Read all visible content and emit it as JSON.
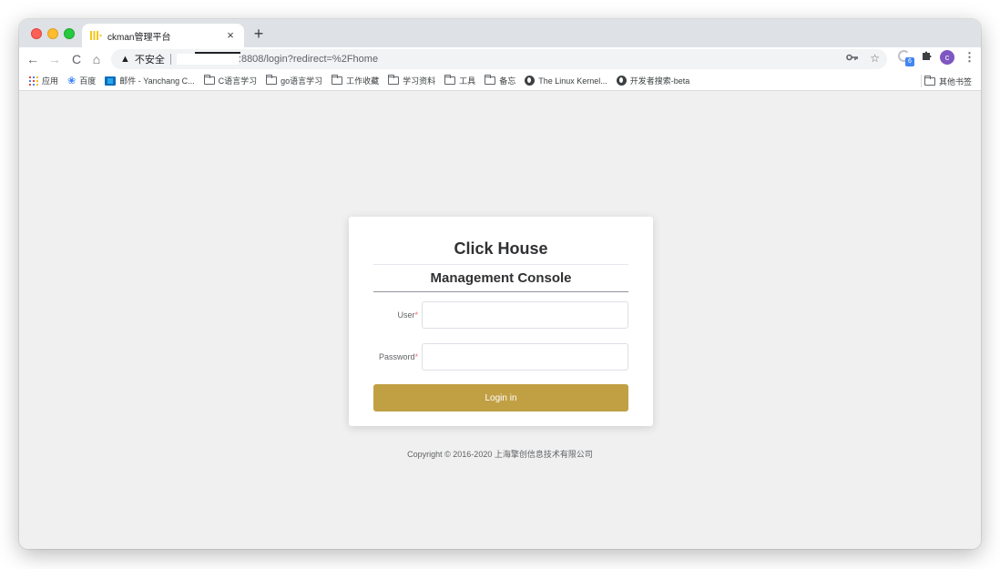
{
  "browser": {
    "tab": {
      "title": "ckman管理平台",
      "close_icon": "×"
    },
    "new_tab_label": "+",
    "nav": {
      "back": "←",
      "forward": "→",
      "reload": "C",
      "home": "⌂"
    },
    "omnibox": {
      "security_icon": "▲",
      "security_label": "不安全",
      "url": ":8808/login?redirect=%2Fhome"
    },
    "toolbar_icons": {
      "key": "🔑",
      "star": "☆",
      "puzzle": "✱",
      "avatar_initial": "c",
      "menu": "⋮",
      "badge": "6"
    },
    "bookmarks": [
      {
        "icon": "apps-grid",
        "label": "应用"
      },
      {
        "icon": "paw",
        "label": "百度"
      },
      {
        "icon": "mail",
        "label": "邮件 - Yanchang C..."
      },
      {
        "icon": "folder",
        "label": "C语言学习"
      },
      {
        "icon": "folder",
        "label": "go语言学习"
      },
      {
        "icon": "folder",
        "label": "工作收藏"
      },
      {
        "icon": "folder",
        "label": "学习资料"
      },
      {
        "icon": "folder",
        "label": "工具"
      },
      {
        "icon": "folder",
        "label": "备忘"
      },
      {
        "icon": "globe",
        "label": "The Linux Kernel..."
      },
      {
        "icon": "globe",
        "label": "开发者搜索-beta"
      }
    ],
    "other_bookmarks": "其他书签"
  },
  "login": {
    "title": "Click House",
    "subtitle": "Management Console",
    "user_label": "User",
    "password_label": "Password",
    "required_mark": "*",
    "user_value": "",
    "password_value": "",
    "button_label": "Login in",
    "accent_color": "#c1a044"
  },
  "footer": {
    "copyright": "Copyright © 2016-2020 上海擎创信息技术有限公司"
  }
}
